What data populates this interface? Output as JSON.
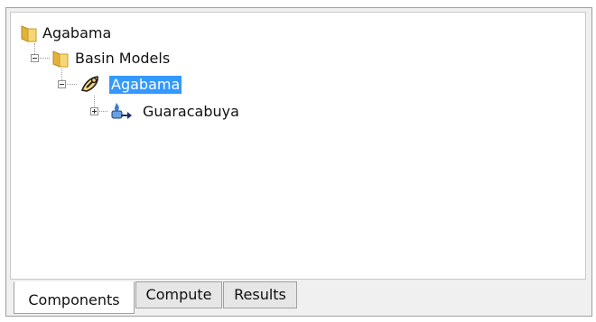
{
  "tree": {
    "root": {
      "label": "Agabama",
      "icon": "folder-icon"
    },
    "basin_models": {
      "label": "Basin Models",
      "icon": "folder-icon",
      "expanded": true
    },
    "basin_model": {
      "label": "Agabama",
      "icon": "wrench-icon",
      "selected": true,
      "expanded": true
    },
    "subbasin": {
      "label": "Guaracabuya",
      "icon": "subbasin-icon",
      "expanded": false
    }
  },
  "tabs": [
    {
      "label": "Components",
      "active": true
    },
    {
      "label": "Compute",
      "active": false
    },
    {
      "label": "Results",
      "active": false
    }
  ],
  "colors": {
    "selection": "#3399ff",
    "folder": "#f2c94c"
  }
}
